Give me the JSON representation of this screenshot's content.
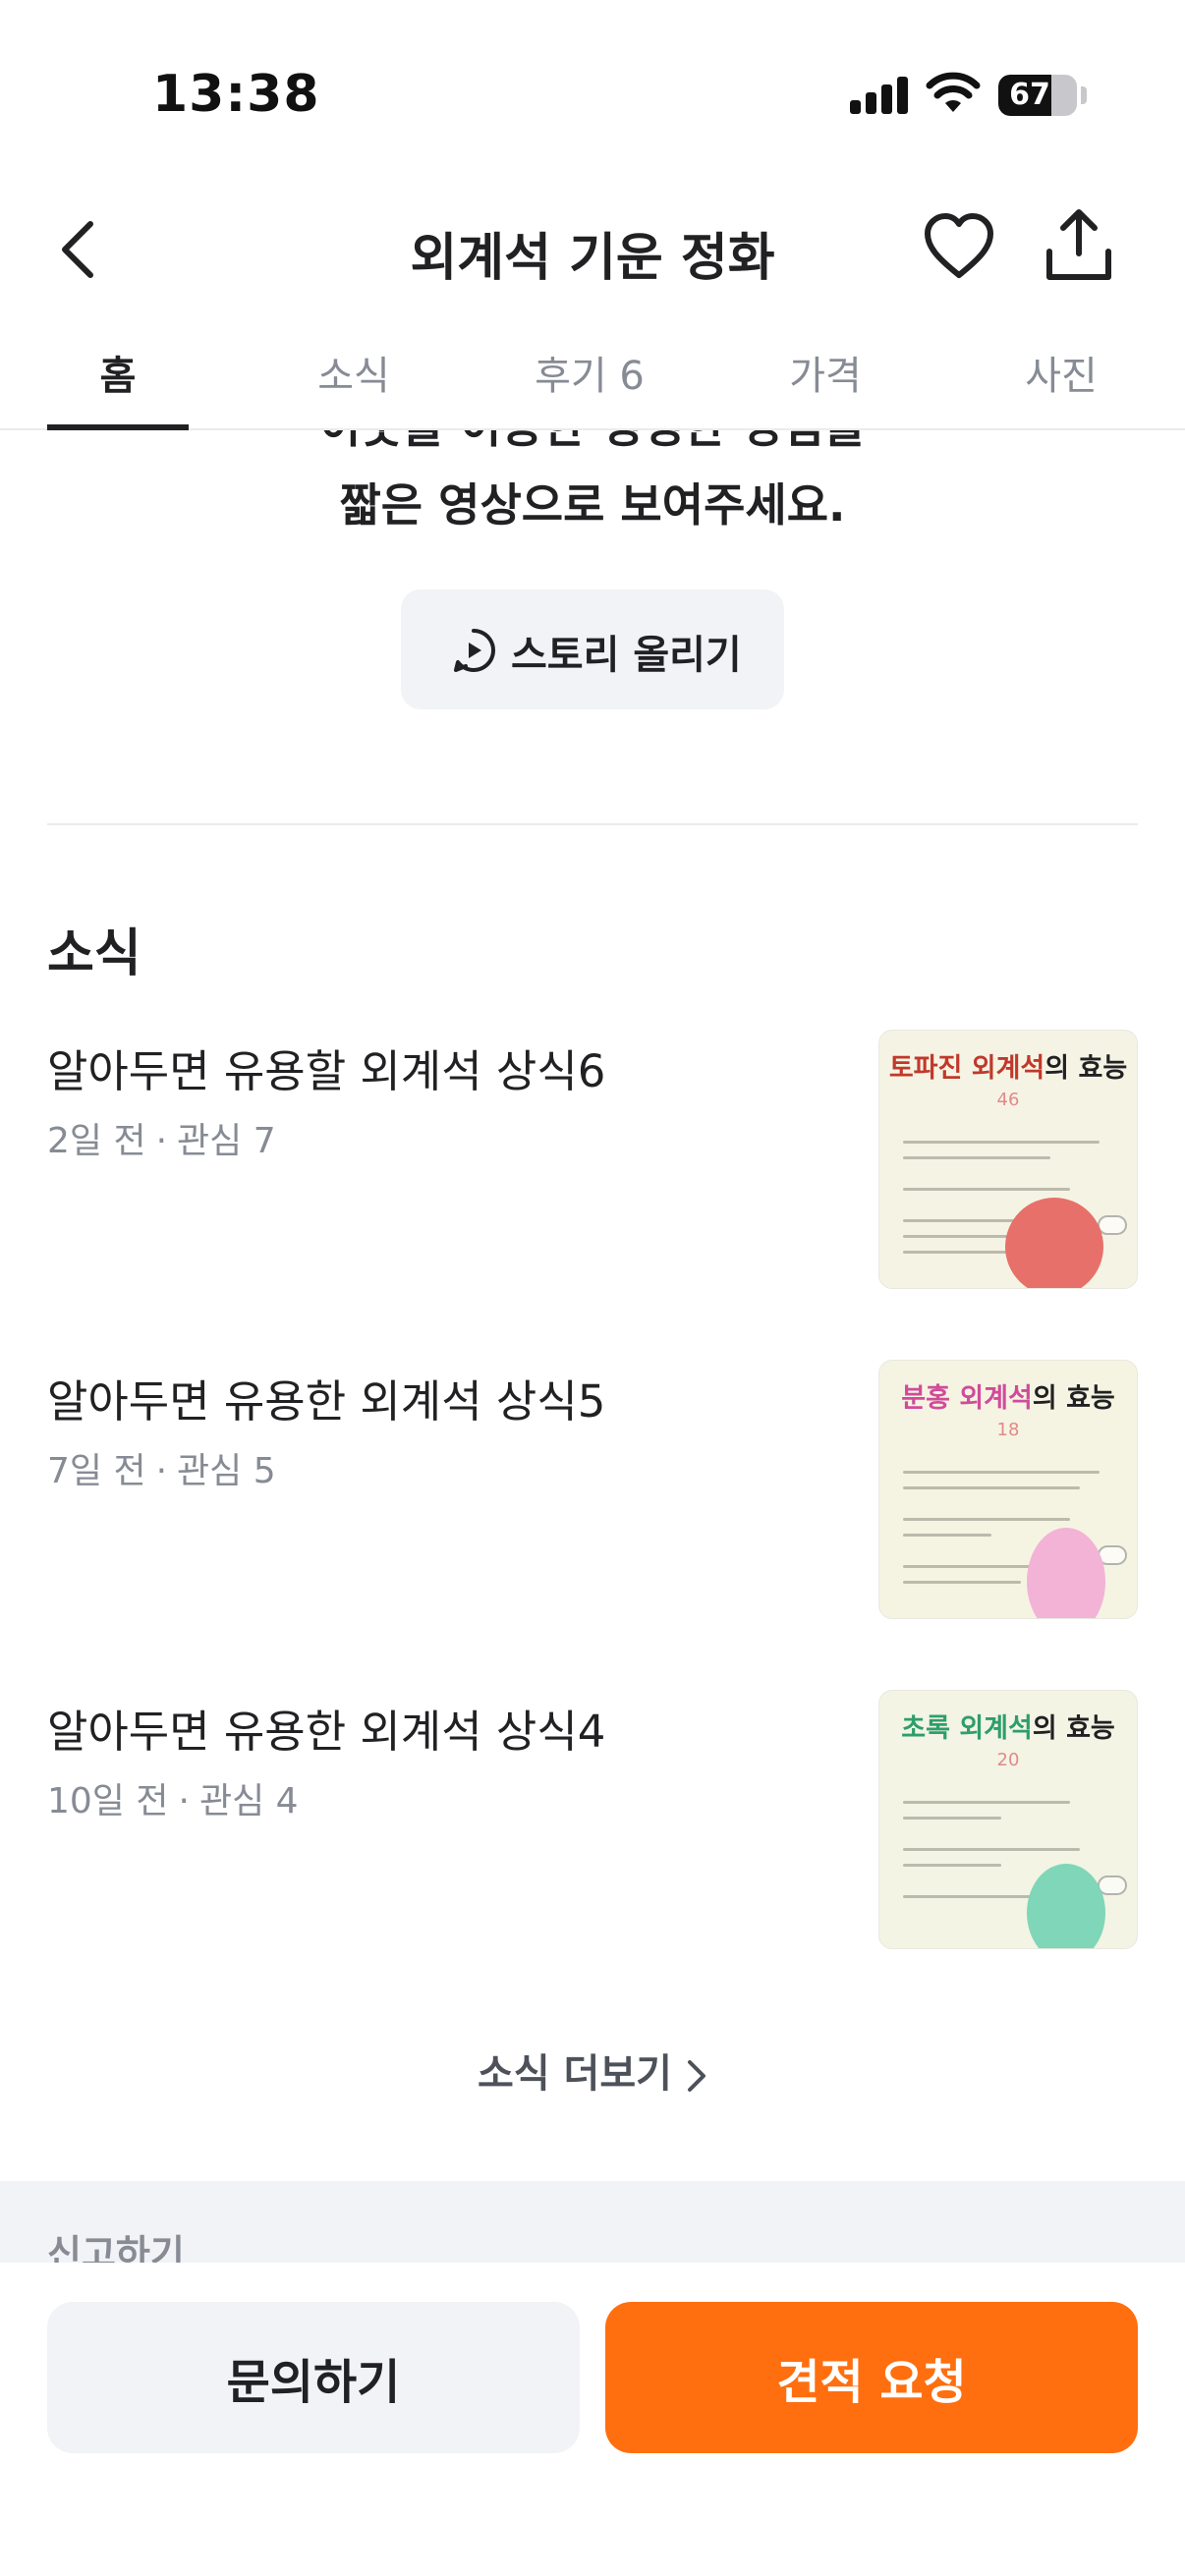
{
  "status_bar": {
    "time": "13:38",
    "battery": "67",
    "battery_level": 0.67
  },
  "header": {
    "title": "외계석 기운 정화"
  },
  "tabs": [
    {
      "label": "홈",
      "active": true
    },
    {
      "label": "소식",
      "active": false
    },
    {
      "label": "후기 6",
      "active": false
    },
    {
      "label": "가격",
      "active": false
    },
    {
      "label": "사진",
      "active": false
    }
  ],
  "story": {
    "prompt_line1": "이웃을 이용한 생생한 경험을",
    "prompt_line2": "짧은 영상으로 보여주세요.",
    "button_label": "스토리 올리기"
  },
  "news": {
    "section_title": "소식",
    "items": [
      {
        "title": "알아두면 유용할 외계석 상식6",
        "age": "2일 전",
        "interest": "관심 7",
        "thumb": {
          "title_colored": "토파진 외계석",
          "title_rest": "의 효능",
          "number": "46",
          "title_color": "#c0392b",
          "blob_color": "#e8706a",
          "bg": "#f5f4e4"
        }
      },
      {
        "title": "알아두면 유용한 외계석 상식5",
        "age": "7일 전",
        "interest": "관심 5",
        "thumb": {
          "title_colored": "분홍 외계석",
          "title_rest": "의 효능",
          "number": "18",
          "title_color": "#d14b9b",
          "blob_color": "#f2b3d6",
          "bg": "#f5f4e2"
        }
      },
      {
        "title": "알아두면 유용한 외계석 상식4",
        "age": "10일 전",
        "interest": "관심 4",
        "thumb": {
          "title_colored": "초록 외계석",
          "title_rest": "의 효능",
          "number": "20",
          "title_color": "#2e9e6a",
          "blob_color": "#7fd6b8",
          "bg": "#f3f4e4"
        }
      }
    ],
    "more_label": "소식 더보기"
  },
  "report": {
    "label": "신고하기"
  },
  "actions": {
    "inquiry": "문의하기",
    "quote": "견적 요청"
  },
  "colors": {
    "primary": "#ff6f0f",
    "text": "#212124",
    "muted": "#868b94",
    "surface": "#f2f3f6"
  }
}
